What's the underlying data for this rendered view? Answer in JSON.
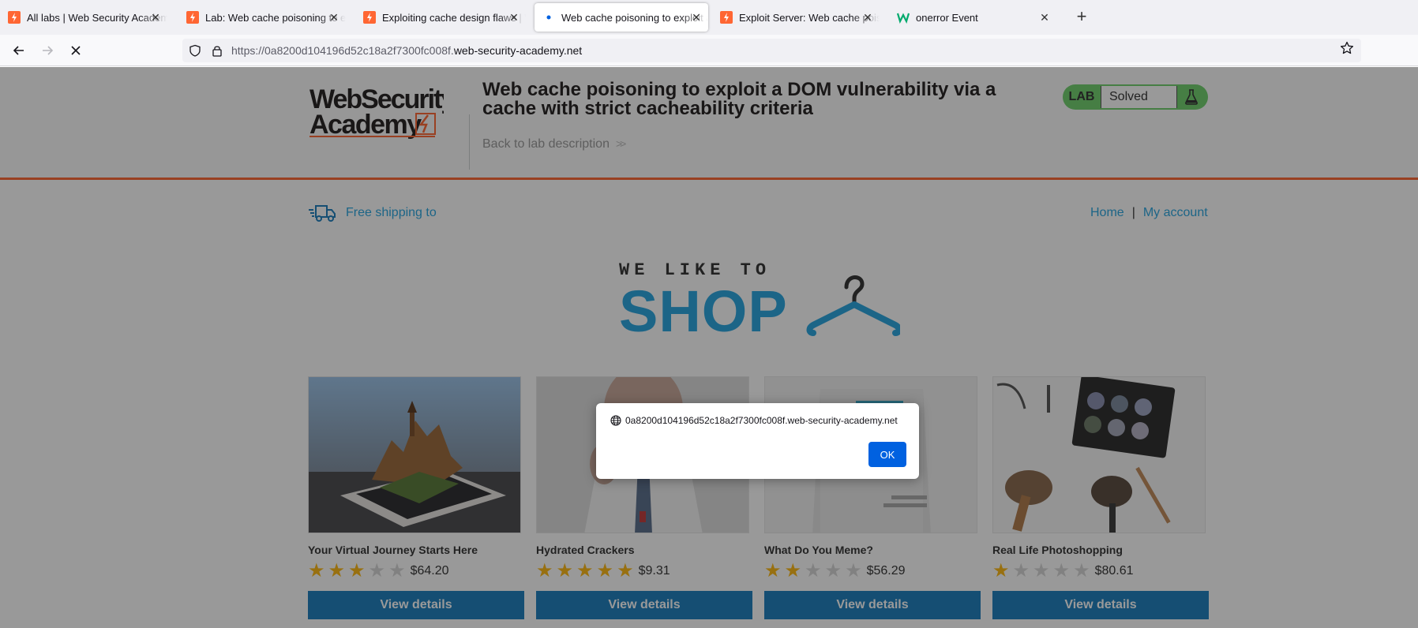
{
  "browser": {
    "tabs": [
      {
        "title": "All labs | Web Security Academy",
        "active": false
      },
      {
        "title": "Lab: Web cache poisoning to exploit a DOM vulnerability",
        "active": false
      },
      {
        "title": "Exploiting cache design flaws | Web Security Academy",
        "active": false
      },
      {
        "title": "Web cache poisoning to exploit a DOM vulnerability",
        "active": true
      },
      {
        "title": "Exploit Server: Web cache poisoning",
        "active": false
      },
      {
        "title": "onerror Event",
        "active": false
      }
    ],
    "url_prefix": "https://0a8200d104196d52c18a2f7300fc008f.",
    "url_host": "web-security-academy.net"
  },
  "lab_header": {
    "title": "Web cache poisoning to exploit a DOM vulnerability via a cache with strict cacheability criteria",
    "back_link": "Back to lab description",
    "lab_label": "LAB",
    "status": "Solved"
  },
  "site": {
    "shipping": "Free shipping to",
    "nav": {
      "home": "Home",
      "separator": "|",
      "account": "My account"
    },
    "banner": {
      "tagline": "WE LIKE TO",
      "word": "SHOP"
    }
  },
  "products": [
    {
      "name": "Your Virtual Journey Starts Here",
      "rating": 3,
      "price": "$64.20",
      "button": "View details"
    },
    {
      "name": "Hydrated Crackers",
      "rating": 5,
      "price": "$9.31",
      "button": "View details"
    },
    {
      "name": "What Do You Meme?",
      "rating": 2,
      "price": "$56.29",
      "button": "View details"
    },
    {
      "name": "Real Life Photoshopping",
      "rating": 1,
      "price": "$80.61",
      "button": "View details"
    }
  ],
  "dialog": {
    "origin": "0a8200d104196d52c18a2f7300fc008f.web-security-academy.net",
    "ok_label": "OK"
  },
  "colors": {
    "accent": "#ff6633",
    "link": "#29a5e0",
    "button": "#1c7fbd",
    "lab_green": "#70d16d",
    "dialog_ok": "#0061e0"
  }
}
